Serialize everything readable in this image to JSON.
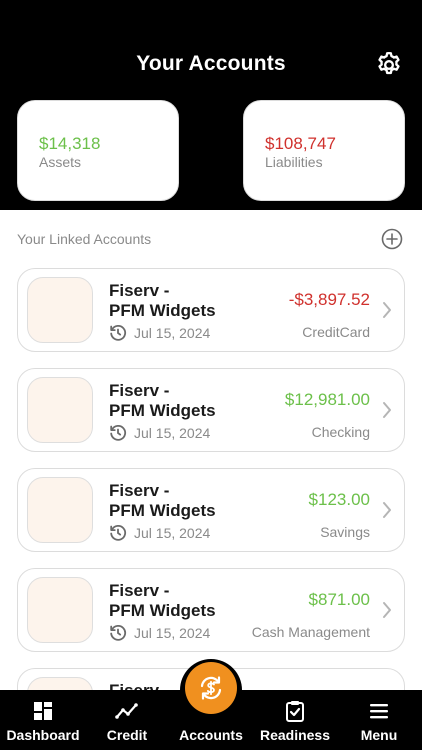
{
  "header": {
    "title": "Your Accounts",
    "settings_icon": "gear-icon"
  },
  "summary": {
    "assets": {
      "amount": "$14,318",
      "label": "Assets",
      "color": "#6cc04a"
    },
    "liabilities": {
      "amount": "$108,747",
      "label": "Liabilities",
      "color": "#d0312d"
    }
  },
  "linked": {
    "title": "Your Linked Accounts",
    "add_icon": "plus-circle-icon",
    "accounts": [
      {
        "name": "Fiserv -\nPFM Widgets",
        "date": "Jul 15, 2024",
        "amount": "-$3,897.52",
        "type": "CreditCard",
        "status": "negative"
      },
      {
        "name": "Fiserv -\nPFM Widgets",
        "date": "Jul 15, 2024",
        "amount": "$12,981.00",
        "type": "Checking",
        "status": "positive"
      },
      {
        "name": "Fiserv -\nPFM Widgets",
        "date": "Jul 15, 2024",
        "amount": "$123.00",
        "type": "Savings",
        "status": "positive"
      },
      {
        "name": "Fiserv -\nPFM Widgets",
        "date": "Jul 15, 2024",
        "amount": "$871.00",
        "type": "Cash Management",
        "status": "positive"
      },
      {
        "name": "Fiserv -",
        "date": "",
        "amount": "",
        "type": "",
        "status": "positive"
      }
    ]
  },
  "tabs": [
    {
      "label": "Dashboard",
      "icon": "dashboard-grid-icon"
    },
    {
      "label": "Credit",
      "icon": "trend-line-icon"
    },
    {
      "label": "Accounts",
      "icon": "sync-dollar-icon",
      "active": true
    },
    {
      "label": "Readiness",
      "icon": "clipboard-check-icon"
    },
    {
      "label": "Menu",
      "icon": "hamburger-menu-icon"
    }
  ]
}
